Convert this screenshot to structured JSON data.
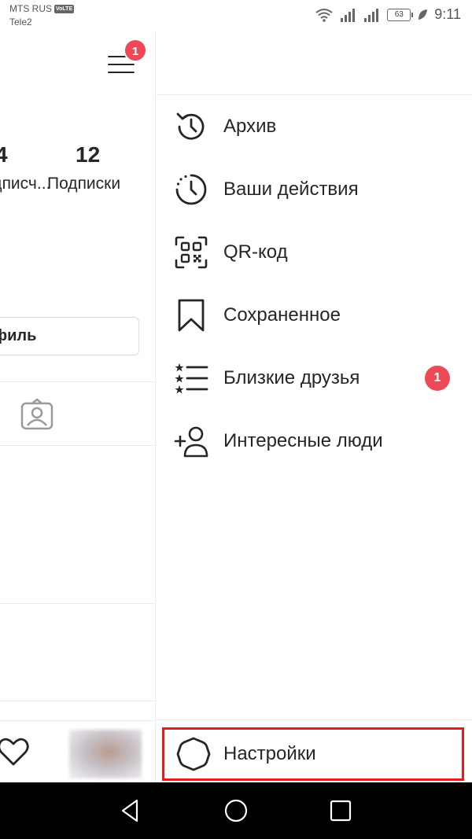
{
  "status_bar": {
    "carrier_primary": "MTS RUS",
    "volte_badge": "VoLTE",
    "carrier_secondary": "Tele2",
    "battery_level": "63",
    "time": "9:11"
  },
  "profile": {
    "menu_badge_count": "1",
    "stats": [
      {
        "value": "4",
        "label": "Подписч..."
      },
      {
        "value": "12",
        "label": "Подписки"
      }
    ],
    "edit_button_label": "Редактировать профиль"
  },
  "drawer": {
    "items": [
      {
        "id": "archive",
        "label": "Архив",
        "icon": "archive-icon"
      },
      {
        "id": "your-activity",
        "label": "Ваши действия",
        "icon": "activity-icon"
      },
      {
        "id": "qr-code",
        "label": "QR-код",
        "icon": "qr-code-icon"
      },
      {
        "id": "saved",
        "label": "Сохраненное",
        "icon": "bookmark-icon"
      },
      {
        "id": "close-friends",
        "label": "Близкие друзья",
        "icon": "close-friends-icon",
        "badge": "1"
      },
      {
        "id": "discover-people",
        "label": "Интересные люди",
        "icon": "add-person-icon"
      }
    ],
    "settings_label": "Настройки"
  },
  "colors": {
    "badge": "#ed4956",
    "highlight": "#e01e1e",
    "text": "#262626"
  }
}
